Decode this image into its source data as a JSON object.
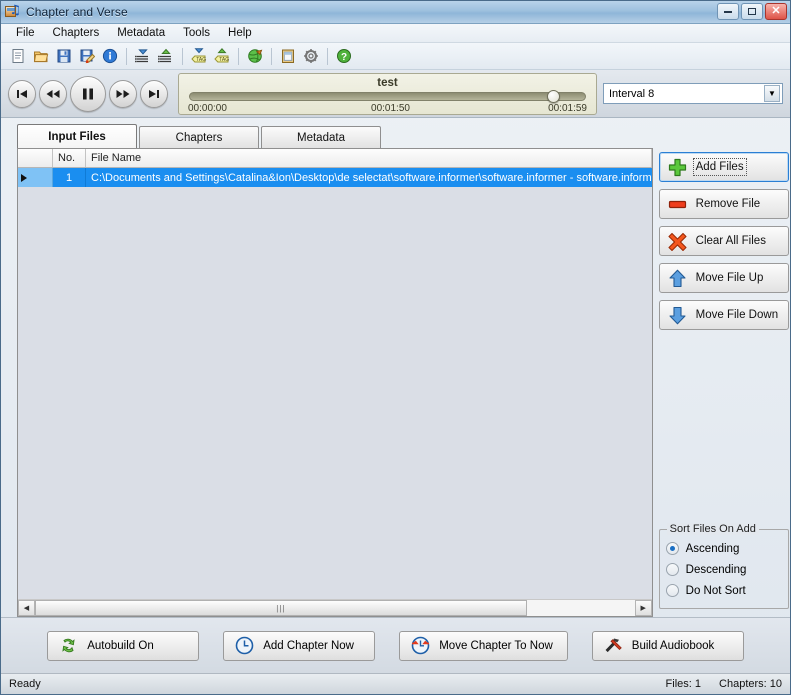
{
  "window": {
    "title": "Chapter and Verse",
    "icon": "app-book-note-icon",
    "minimize_label": "",
    "maximize_label": "",
    "close_label": "✕"
  },
  "menu": [
    {
      "label": "File"
    },
    {
      "label": "Chapters"
    },
    {
      "label": "Metadata"
    },
    {
      "label": "Tools"
    },
    {
      "label": "Help"
    }
  ],
  "toolbar": [
    {
      "name": "new-file-icon"
    },
    {
      "name": "open-folder-icon"
    },
    {
      "name": "save-icon"
    },
    {
      "name": "save-as-icon"
    },
    {
      "name": "info-icon"
    },
    {
      "name": "import-list-icon"
    },
    {
      "name": "export-list-icon"
    },
    {
      "name": "import-tag-icon"
    },
    {
      "name": "export-tag-icon"
    },
    {
      "name": "globe-icon"
    },
    {
      "name": "clipboard-icon"
    },
    {
      "name": "settings-gear-icon"
    },
    {
      "name": "help-icon"
    }
  ],
  "player": {
    "buttons": [
      {
        "name": "previous-track-button"
      },
      {
        "name": "rewind-button"
      },
      {
        "name": "pause-button"
      },
      {
        "name": "fast-forward-button"
      },
      {
        "name": "next-track-button"
      }
    ],
    "track_name": "test",
    "time_start": "00:00:00",
    "time_current": "00:01:50",
    "time_total": "00:01:59",
    "progress_percent": 92
  },
  "interval": {
    "selected": "Interval 8",
    "arrow": "▼"
  },
  "tabs": [
    {
      "label": "Input Files",
      "active": true
    },
    {
      "label": "Chapters",
      "active": false
    },
    {
      "label": "Metadata",
      "active": false
    }
  ],
  "grid": {
    "columns": [
      "",
      "No.",
      "File Name"
    ],
    "rows": [
      {
        "no": "1",
        "file_name": "C:\\Documents and Settings\\Catalina&Ion\\Desktop\\de selectat\\software.informer\\software.informer - software.inform"
      }
    ],
    "scroll_thumb_glyph": "|||",
    "scroll_left_arrow": "◀",
    "scroll_right_arrow": "▶"
  },
  "sidebar": {
    "buttons": [
      {
        "label": "Add Files",
        "icon": "plus-icon",
        "focused": true
      },
      {
        "label": "Remove File",
        "icon": "minus-icon",
        "focused": false
      },
      {
        "label": "Clear All Files",
        "icon": "cross-icon",
        "focused": false
      },
      {
        "label": "Move File Up",
        "icon": "arrow-up-icon",
        "focused": false
      },
      {
        "label": "Move File Down",
        "icon": "arrow-down-icon",
        "focused": false
      }
    ],
    "sort_group": {
      "title": "Sort Files On Add",
      "options": [
        {
          "label": "Ascending",
          "selected": true
        },
        {
          "label": "Descending",
          "selected": false
        },
        {
          "label": "Do Not Sort",
          "selected": false
        }
      ]
    }
  },
  "bottom_actions": [
    {
      "label": "Autobuild On",
      "icon": "recycle-icon"
    },
    {
      "label": "Add Chapter Now",
      "icon": "clock-icon"
    },
    {
      "label": "Move Chapter To Now",
      "icon": "clock-move-icon"
    },
    {
      "label": "Build Audiobook",
      "icon": "tools-icon"
    }
  ],
  "status": {
    "message": "Ready",
    "files": "Files: 1",
    "chapters": "Chapters: 10"
  },
  "colors": {
    "selection_blue": "#1a8ef0",
    "title_blue": "#9dc0de",
    "accent_green": "#4caf2a",
    "accent_red": "#e33b1e"
  }
}
